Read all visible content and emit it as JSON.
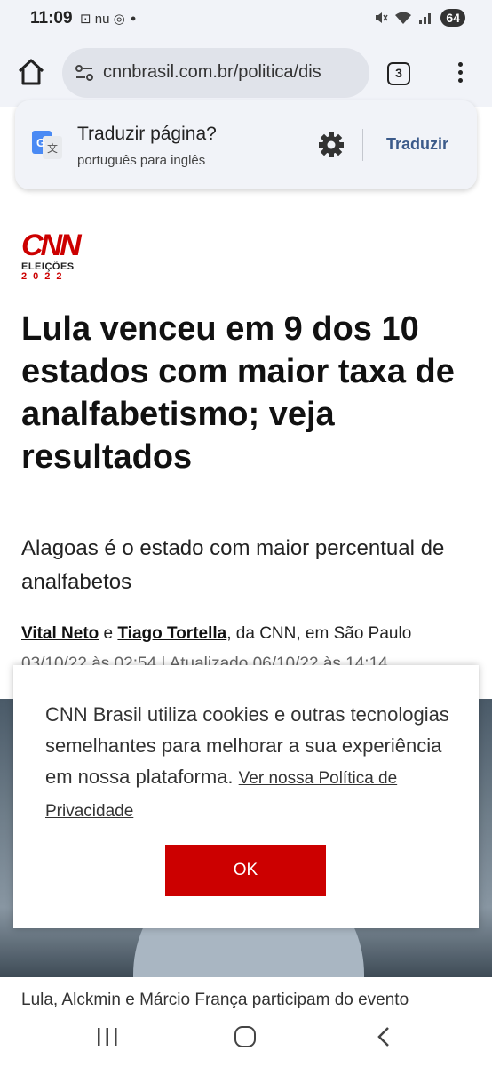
{
  "status_bar": {
    "time": "11:09",
    "left_icons": "⊡ nu ◎",
    "battery": "64"
  },
  "browser": {
    "url": "cnnbrasil.com.br/politica/dis",
    "tab_count": "3"
  },
  "translate": {
    "title": "Traduzir página?",
    "subtitle": "português para inglês",
    "button": "Traduzir"
  },
  "logo": {
    "brand": "CNN",
    "line1": "ELEIÇÕES",
    "line2": "2022"
  },
  "article": {
    "headline": "Lula venceu em 9 dos 10 estados com maior taxa de analfabetismo; veja resultados",
    "subtitle": "Alagoas é o estado com maior percentual de analfabetos",
    "author1": "Vital Neto",
    "connector": " e ",
    "author2": "Tiago Tortella",
    "location": ", da CNN, em São Paulo",
    "dateline": "03/10/22 às 02:54 | Atualizado 06/10/22 às 14:14",
    "caption": "Lula, Alckmin e Márcio França participam do evento"
  },
  "cookie": {
    "text": "CNN Brasil utiliza cookies e outras tecnologias semelhantes para melhorar a sua experiência em nossa plataforma.",
    "link": "Ver nossa Política de Privacidade",
    "ok": "OK"
  }
}
